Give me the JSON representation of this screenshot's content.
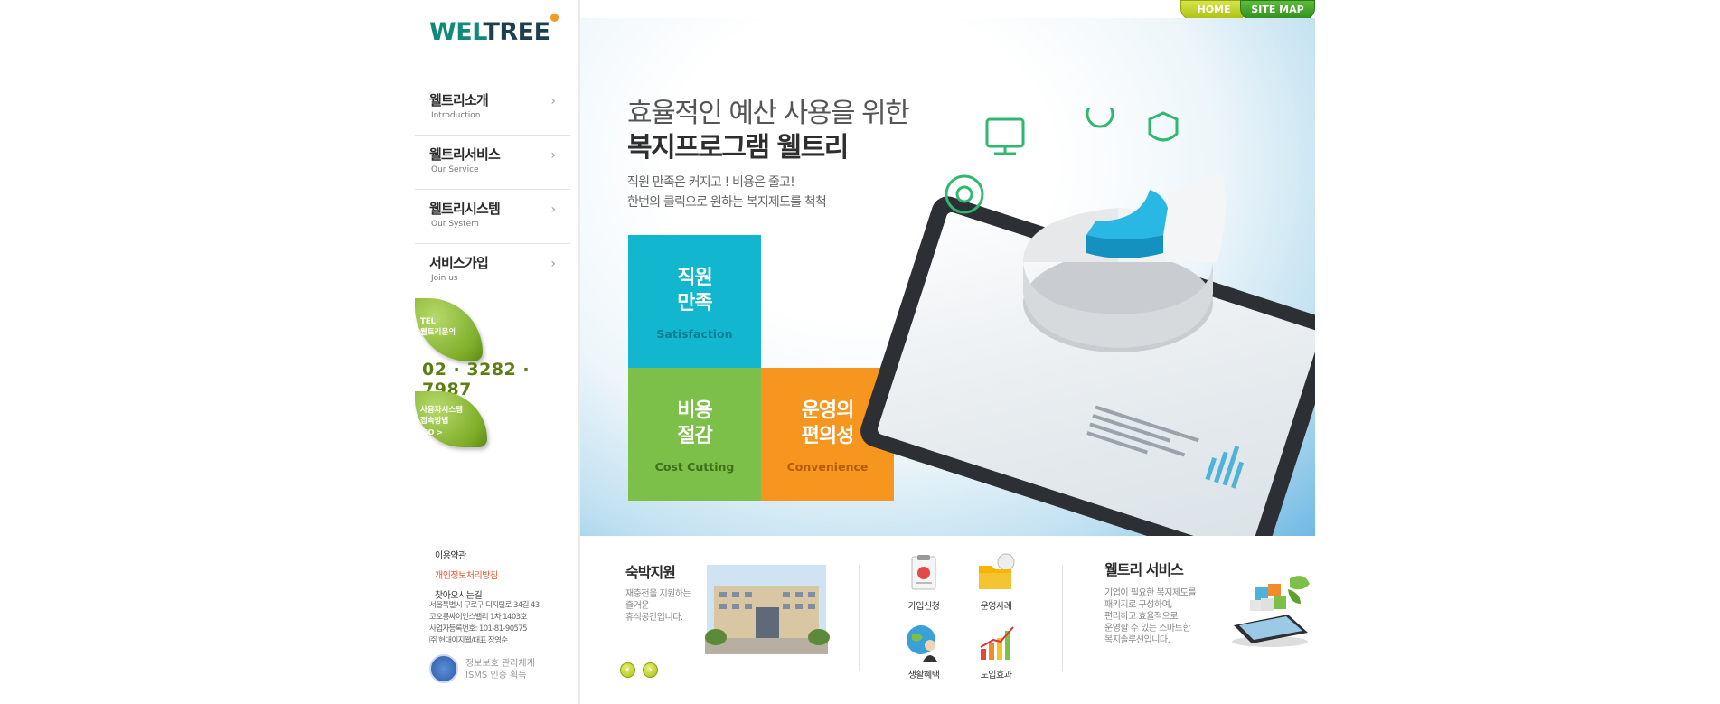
{
  "top_nav": {
    "home": "HOME",
    "sitemap": "SITE MAP"
  },
  "logo": {
    "part1": "WEL",
    "part2": "TREE"
  },
  "sidebar": {
    "items": [
      {
        "label": "웰트리소개",
        "sub": "Introduction"
      },
      {
        "label": "웰트리서비스",
        "sub": "Our Service"
      },
      {
        "label": "웰트리시스템",
        "sub": "Our System"
      },
      {
        "label": "서비스가입",
        "sub": "Join us"
      }
    ],
    "tel_line1": "TEL",
    "tel_line2": "웰트리문의",
    "tel_number": "02 · 3282 · 7987",
    "user_line1": "사용자시스템",
    "user_line2": "접속방법",
    "user_go": "GO >",
    "footer_links": [
      "이용약관",
      "개인정보처리방침",
      "찾아오시는길"
    ],
    "address": [
      "서울특별시 구로구 디지털로 34길 43",
      "코오롱싸이언스밸리 1차 1403호",
      "사업자등록번호: 101-81-90575",
      "㈜ 현대이지웰/대표 장영순"
    ],
    "isms_line1": "정보보호 관리체계",
    "isms_line2": "ISMS 인증 획득"
  },
  "hero": {
    "title_line1": "효율적인 예산 사용을 위한",
    "title_line2": "복지프로그램 웰트리",
    "desc_line1": "직원 만족은 커지고 ! 비용은 줄고!",
    "desc_line2": "한번의 클릭으로 원하는 복지제도를 척척",
    "tiles": [
      {
        "line1": "직원",
        "line2": "만족",
        "sub": "Satisfaction",
        "color": "#13b6cf"
      },
      {
        "line1": "비용",
        "line2": "절감",
        "sub": "Cost Cutting",
        "color": "#7cbf49"
      },
      {
        "line1": "운영의",
        "line2": "편의성",
        "sub": "Convenience",
        "color": "#f7961f"
      }
    ]
  },
  "bottom": {
    "lodging_title": "숙박지원",
    "lodging_desc": [
      "재충전을 지원하는",
      "즐거운",
      "휴식공간입니다."
    ],
    "quick_links": [
      "가입신청",
      "운영사례",
      "생활혜택",
      "도입효과"
    ],
    "service_title": "웰트리 서비스",
    "service_desc": [
      "기업이 필요한 복지제도를",
      "패키지로 구성하여,",
      "편리하고 효율적으로",
      "운영할 수 있는 스마트한",
      "복지솔루션입니다."
    ]
  }
}
